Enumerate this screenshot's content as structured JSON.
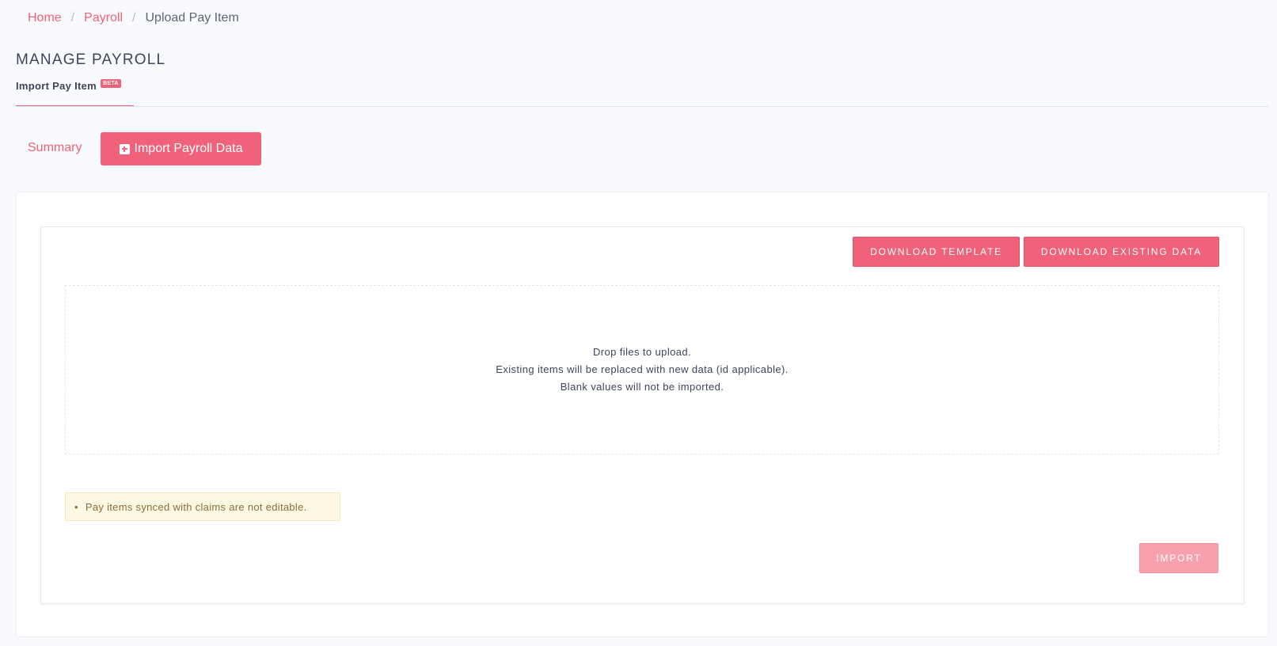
{
  "breadcrumb": {
    "home": "Home",
    "payroll": "Payroll",
    "current": "Upload Pay Item",
    "separator": "/"
  },
  "header": {
    "title": "MANAGE PAYROLL",
    "subtab": "Import Pay Item",
    "badge": "BETA"
  },
  "actions": {
    "summary": "Summary",
    "import_data": "Import Payroll Data"
  },
  "panel": {
    "download_template": "DOWNLOAD TEMPLATE",
    "download_existing": "DOWNLOAD EXISTING DATA",
    "dropzone": [
      "Drop files to upload.",
      "Existing items will be replaced with new data (id applicable).",
      "Blank values will not be imported."
    ],
    "warning_bullet": "•",
    "warning": "Pay items synced with claims are not editable.",
    "import": "IMPORT"
  },
  "colors": {
    "accent": "#f06279",
    "accent_disabled": "#f7a0ae",
    "warning_bg": "#fdf8e3",
    "warning_text": "#8a6d3b",
    "page_bg": "#f9fafd"
  }
}
